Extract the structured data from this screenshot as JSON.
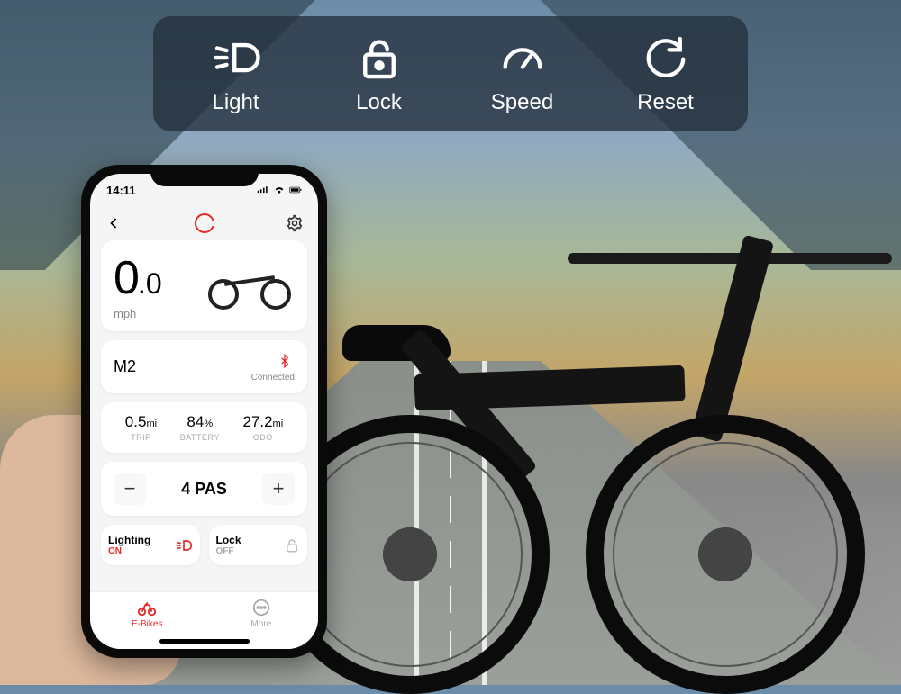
{
  "features": {
    "light": "Light",
    "lock": "Lock",
    "speed": "Speed",
    "reset": "Reset"
  },
  "status": {
    "time": "14:11"
  },
  "app": {
    "speed_int": "0",
    "speed_dec": ".0",
    "speed_unit": "mph",
    "model": "M2",
    "connection": "Connected",
    "stats": {
      "trip_val": "0.5",
      "trip_unit": "mi",
      "trip_label": "TRIP",
      "battery_val": "84",
      "battery_unit": "%",
      "battery_label": "BATTERY",
      "odo_val": "27.2",
      "odo_unit": "mi",
      "odo_label": "ODO"
    },
    "pas": {
      "minus": "−",
      "value": "4 PAS",
      "plus": "+"
    },
    "toggles": {
      "lighting_title": "Lighting",
      "lighting_state": "ON",
      "lock_title": "Lock",
      "lock_state": "OFF"
    },
    "tabs": {
      "ebikes": "E-Bikes",
      "more": "More"
    }
  }
}
